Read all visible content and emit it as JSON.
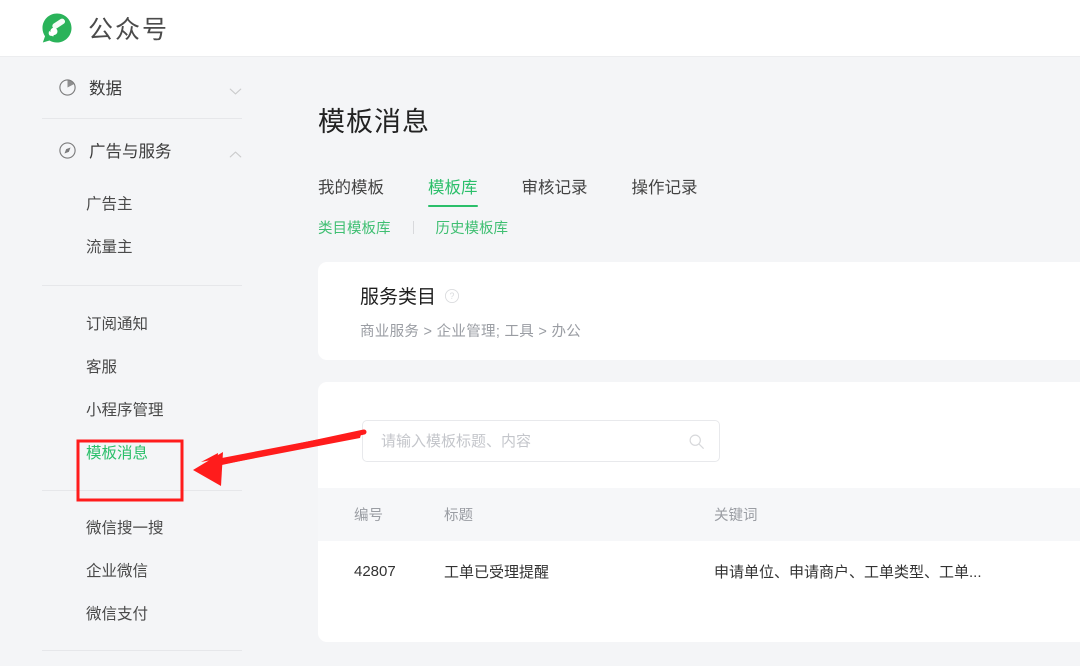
{
  "header": {
    "logo_icon": "wechat-official-account-logo",
    "title": "公众号"
  },
  "sidebar": {
    "groups": [
      {
        "icon": "pie-chart-icon",
        "label": "数据",
        "chevron": "chevron-down-icon",
        "expanded": false,
        "items": []
      },
      {
        "icon": "compass-icon",
        "label": "广告与服务",
        "chevron": "chevron-up-icon",
        "expanded": true,
        "items": [
          {
            "label": "广告主",
            "active": false
          },
          {
            "label": "流量主",
            "active": false
          }
        ]
      }
    ],
    "section_two": [
      {
        "label": "订阅通知",
        "active": false
      },
      {
        "label": "客服",
        "active": false
      },
      {
        "label": "小程序管理",
        "active": false
      },
      {
        "label": "模板消息",
        "active": true
      }
    ],
    "section_three": [
      {
        "label": "微信搜一搜",
        "active": false
      },
      {
        "label": "企业微信",
        "active": false
      },
      {
        "label": "微信支付",
        "active": false
      }
    ]
  },
  "main": {
    "page_title": "模板消息",
    "tabs": [
      {
        "label": "我的模板",
        "active": false
      },
      {
        "label": "模板库",
        "active": true
      },
      {
        "label": "审核记录",
        "active": false
      },
      {
        "label": "操作记录",
        "active": false
      }
    ],
    "subtabs": [
      {
        "label": "类目模板库"
      },
      {
        "label": "历史模板库"
      }
    ],
    "category_card": {
      "title": "服务类目",
      "help_icon": "question-circle-icon",
      "path": "商业服务 > 企业管理; 工具 > 办公"
    },
    "search": {
      "placeholder": "请输入模板标题、内容",
      "value": "",
      "icon": "search-icon"
    },
    "table": {
      "columns": [
        "编号",
        "标题",
        "关键词"
      ],
      "rows": [
        {
          "id": "42807",
          "title": "工单已受理提醒",
          "keywords": "申请单位、申请商户、工单类型、工单..."
        }
      ]
    }
  },
  "annotation": {
    "highlight_color": "#ff1c1c",
    "box_label": "模板消息",
    "arrow": "left-pointing-arrow"
  },
  "colors": {
    "brand_green": "#2bbf6a",
    "logo_green": "#27b558",
    "page_bg": "#f4f5f7",
    "card_bg": "#ffffff",
    "annotation_red": "#ff1c1c"
  }
}
